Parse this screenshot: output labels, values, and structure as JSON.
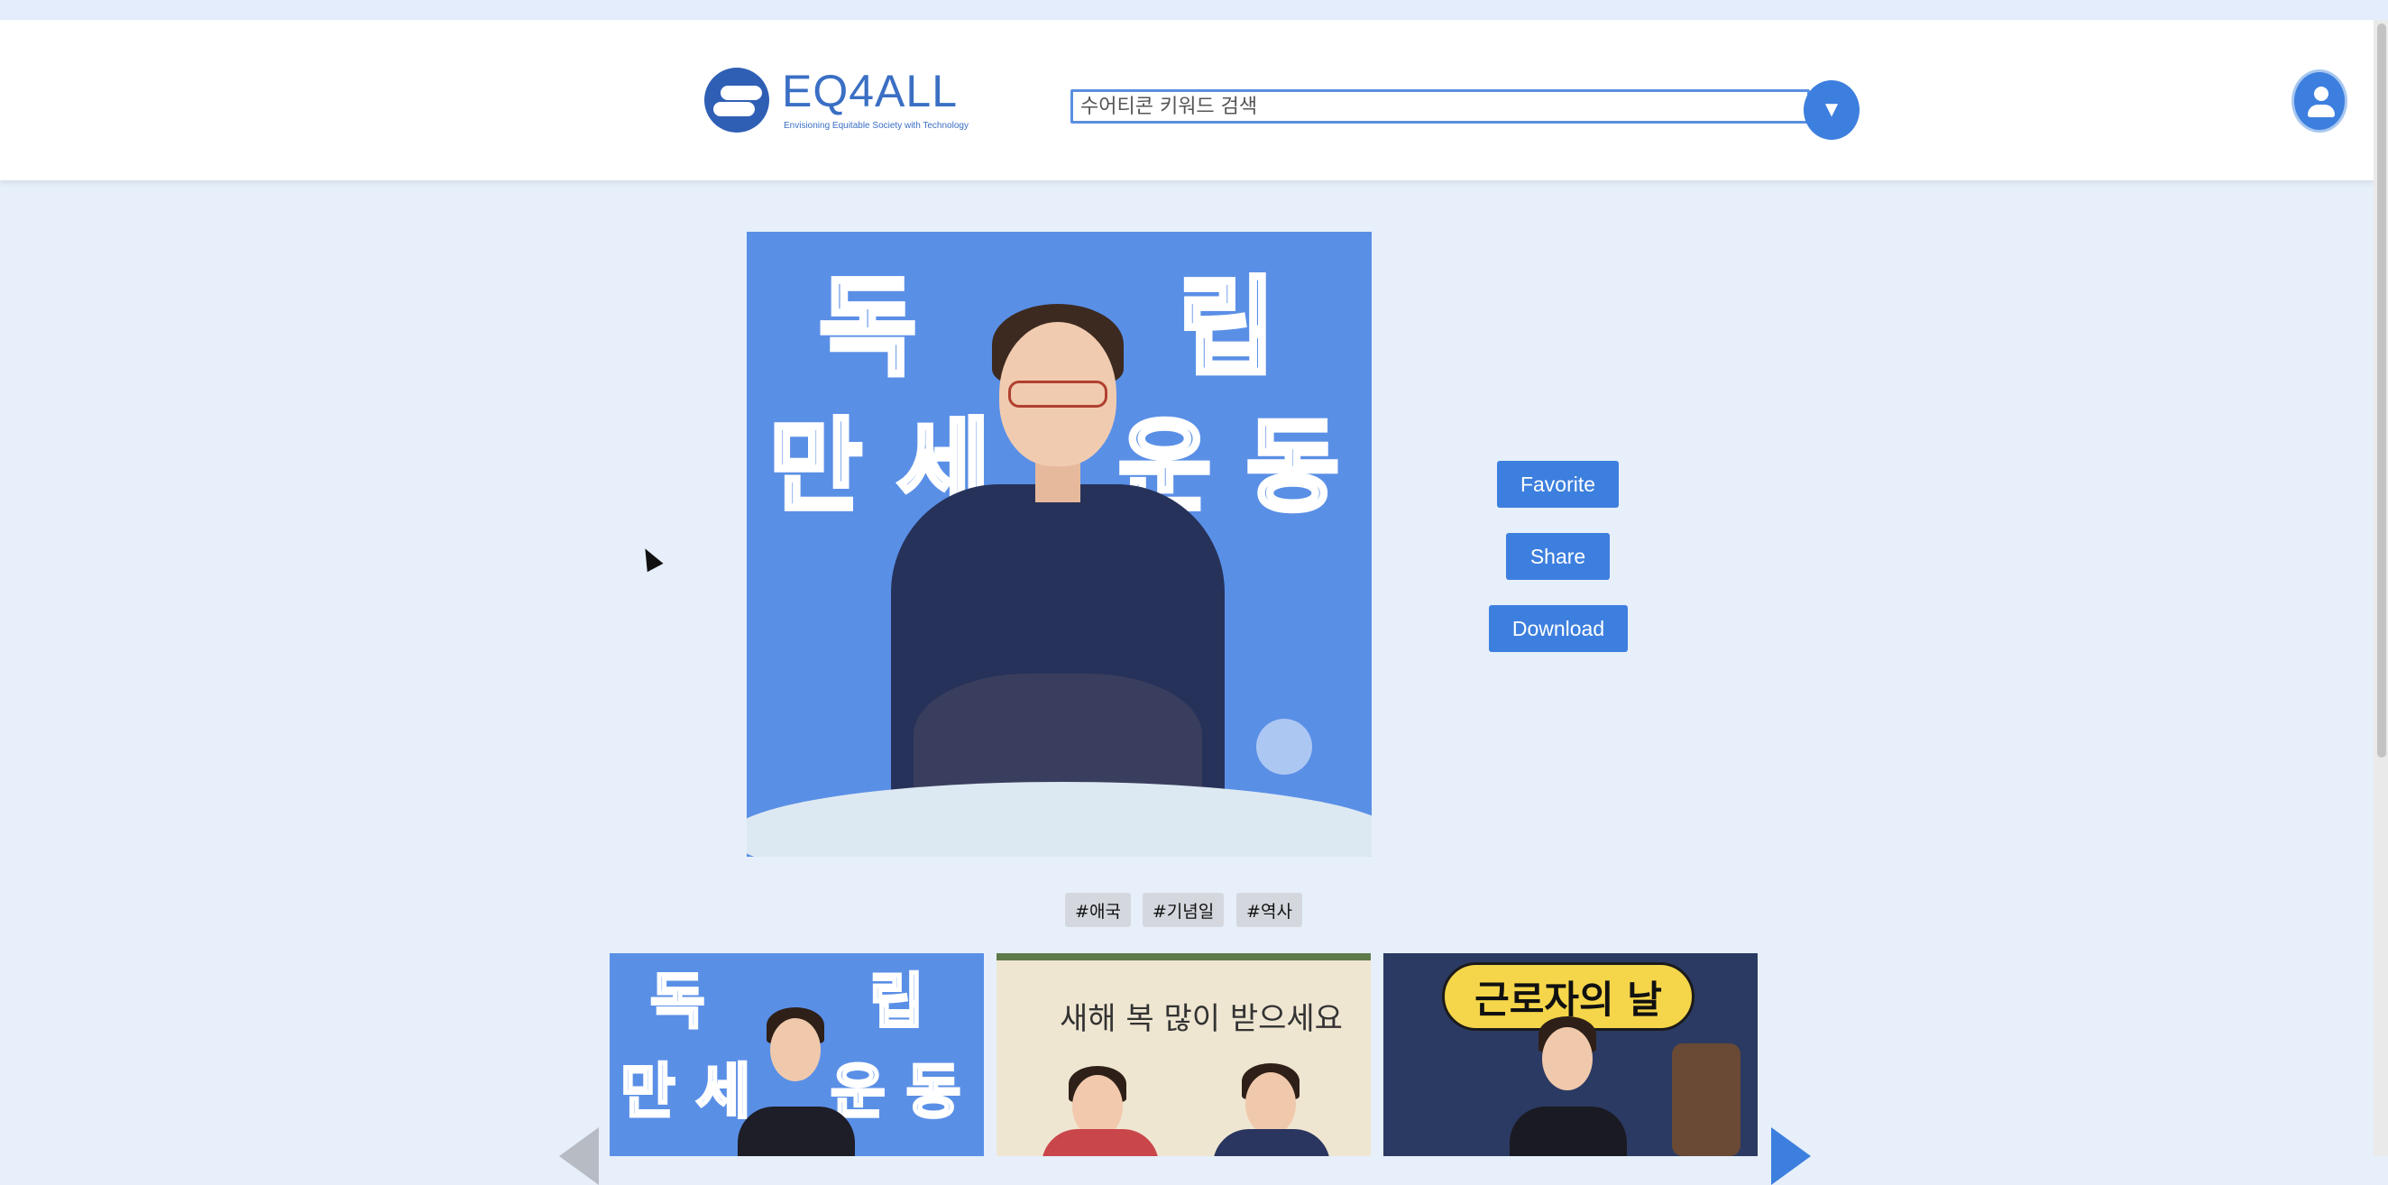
{
  "header": {
    "logo_text": "EQ4ALL",
    "logo_tagline": "Envisioning Equitable Society with Technology",
    "search_placeholder": "수어티콘 키워드 검색",
    "search_button_icon": "▼",
    "user_icon": "user-icon"
  },
  "main_image": {
    "title_line1_left": "독",
    "title_line1_right": "립",
    "title_line2_left": "만 세",
    "title_line2_right": "운 동"
  },
  "actions": {
    "favorite": "Favorite",
    "share": "Share",
    "download": "Download"
  },
  "tags": [
    "#애국",
    "#기념일",
    "#역사"
  ],
  "related": [
    {
      "title_line1_left": "독",
      "title_line1_right": "립",
      "title_line2_left": "만 세",
      "title_line2_right": "운 동"
    },
    {
      "caption": "새해 복 많이 받으세요"
    },
    {
      "caption": "근로자의 날"
    }
  ],
  "colors": {
    "accent": "#3d7fde",
    "page_bg": "#e6effa",
    "tag_bg": "#d4d8de"
  }
}
